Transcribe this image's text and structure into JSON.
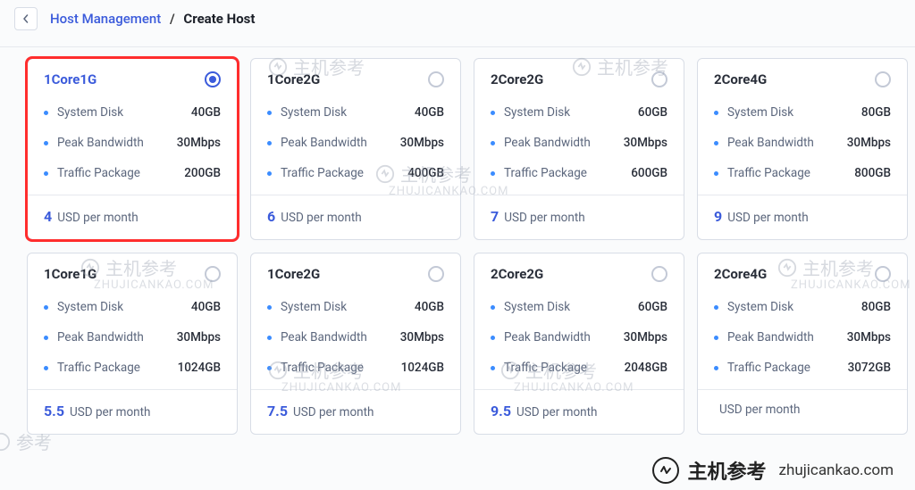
{
  "breadcrumb": {
    "parent": "Host Management",
    "separator": "/",
    "current": "Create Host"
  },
  "spec_labels": {
    "disk": "System Disk",
    "bandwidth": "Peak Bandwidth",
    "traffic": "Traffic Package"
  },
  "price_suffix": "USD per month",
  "plans": [
    {
      "title": "1Core1G",
      "selected": true,
      "highlighted": true,
      "disk": "40GB",
      "bandwidth": "30Mbps",
      "traffic": "200GB",
      "price": "4"
    },
    {
      "title": "1Core2G",
      "selected": false,
      "highlighted": false,
      "disk": "40GB",
      "bandwidth": "30Mbps",
      "traffic": "400GB",
      "price": "6"
    },
    {
      "title": "2Core2G",
      "selected": false,
      "highlighted": false,
      "disk": "60GB",
      "bandwidth": "30Mbps",
      "traffic": "600GB",
      "price": "7"
    },
    {
      "title": "2Core4G",
      "selected": false,
      "highlighted": false,
      "disk": "80GB",
      "bandwidth": "30Mbps",
      "traffic": "800GB",
      "price": "9"
    },
    {
      "title": "1Core1G",
      "selected": false,
      "highlighted": false,
      "disk": "40GB",
      "bandwidth": "30Mbps",
      "traffic": "1024GB",
      "price": "5.5"
    },
    {
      "title": "1Core2G",
      "selected": false,
      "highlighted": false,
      "disk": "40GB",
      "bandwidth": "30Mbps",
      "traffic": "1024GB",
      "price": "7.5"
    },
    {
      "title": "2Core2G",
      "selected": false,
      "highlighted": false,
      "disk": "60GB",
      "bandwidth": "30Mbps",
      "traffic": "2048GB",
      "price": "9.5"
    },
    {
      "title": "2Core4G",
      "selected": false,
      "highlighted": false,
      "disk": "80GB",
      "bandwidth": "30Mbps",
      "traffic": "3072GB",
      "price": ""
    }
  ],
  "watermark": {
    "cn": "主机参考",
    "url": "zhujicankao.com",
    "url_upper": "ZHUJICANKAO.COM"
  }
}
